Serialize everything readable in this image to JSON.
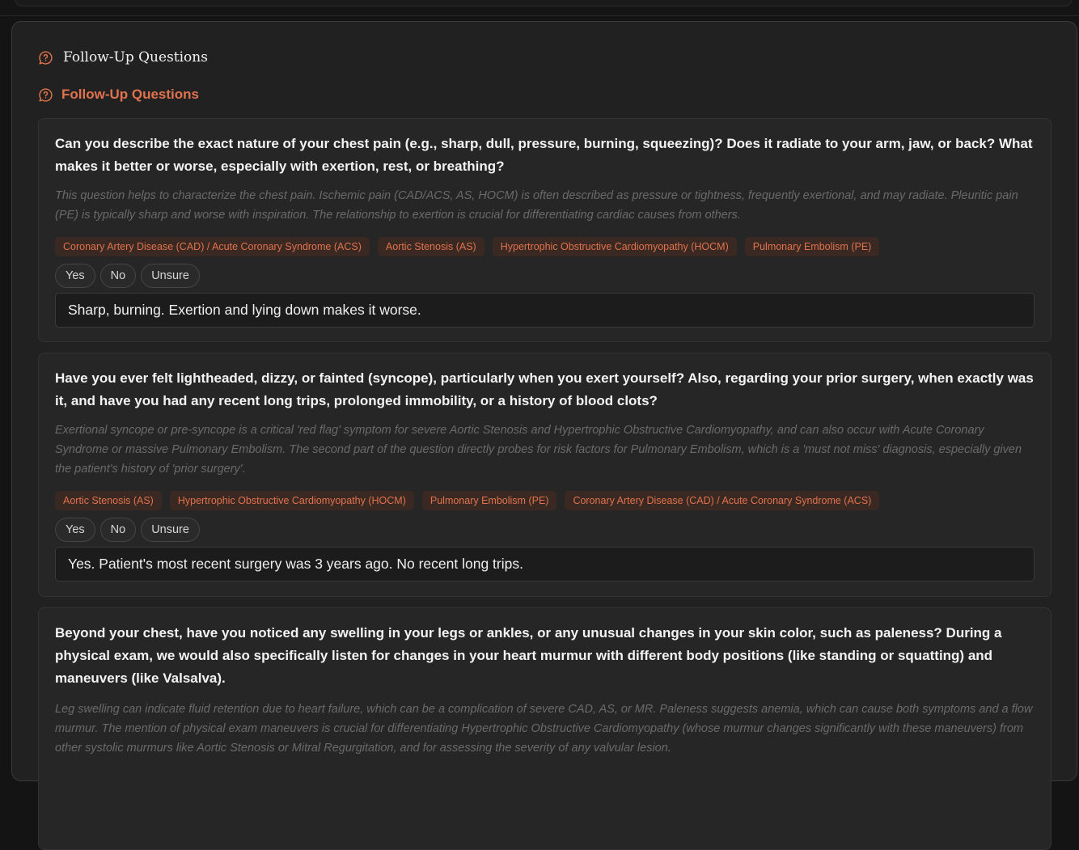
{
  "header": {
    "title": "Follow-Up Questions",
    "title_icon": "question-bubble-icon"
  },
  "section": {
    "title": "Follow-Up Questions",
    "title_icon": "question-bubble-icon",
    "accent_color": "#e0734d"
  },
  "questions": [
    {
      "text": "Can you describe the exact nature of your chest pain (e.g., sharp, dull, pressure, burning, squeezing)? Does it radiate to your arm, jaw, or back? What makes it better or worse, especially with exertion, rest, or breathing?",
      "rationale": "This question helps to characterize the chest pain. Ischemic pain (CAD/ACS, AS, HOCM) is often described as pressure or tightness, frequently exertional, and may radiate. Pleuritic pain (PE) is typically sharp and worse with inspiration. The relationship to exertion is crucial for differentiating cardiac causes from others.",
      "tags": [
        "Coronary Artery Disease (CAD) / Acute Coronary Syndrome (ACS)",
        "Aortic Stenosis (AS)",
        "Hypertrophic Obstructive Cardiomyopathy (HOCM)",
        "Pulmonary Embolism (PE)"
      ],
      "options": [
        "Yes",
        "No",
        "Unsure"
      ],
      "answer": "Sharp, burning. Exertion and lying down makes it worse."
    },
    {
      "text": "Have you ever felt lightheaded, dizzy, or fainted (syncope), particularly when you exert yourself? Also, regarding your prior surgery, when exactly was it, and have you had any recent long trips, prolonged immobility, or a history of blood clots?",
      "rationale": "Exertional syncope or pre-syncope is a critical 'red flag' symptom for severe Aortic Stenosis and Hypertrophic Obstructive Cardiomyopathy, and can also occur with Acute Coronary Syndrome or massive Pulmonary Embolism. The second part of the question directly probes for risk factors for Pulmonary Embolism, which is a 'must not miss' diagnosis, especially given the patient's history of 'prior surgery'.",
      "tags": [
        "Aortic Stenosis (AS)",
        "Hypertrophic Obstructive Cardiomyopathy (HOCM)",
        "Pulmonary Embolism (PE)",
        "Coronary Artery Disease (CAD) / Acute Coronary Syndrome (ACS)"
      ],
      "options": [
        "Yes",
        "No",
        "Unsure"
      ],
      "answer": "Yes. Patient's most recent surgery was 3 years ago. No recent long trips."
    },
    {
      "text": "Beyond your chest, have you noticed any swelling in your legs or ankles, or any unusual changes in your skin color, such as paleness? During a physical exam, we would also specifically listen for changes in your heart murmur with different body positions (like standing or squatting) and maneuvers (like Valsalva).",
      "rationale": "Leg swelling can indicate fluid retention due to heart failure, which can be a complication of severe CAD, AS, or MR. Paleness suggests anemia, which can cause both symptoms and a flow murmur. The mention of physical exam maneuvers is crucial for differentiating Hypertrophic Obstructive Cardiomyopathy (whose murmur changes significantly with these maneuvers) from other systolic murmurs like Aortic Stenosis or Mitral Regurgitation, and for assessing the severity of any valvular lesion."
    }
  ]
}
